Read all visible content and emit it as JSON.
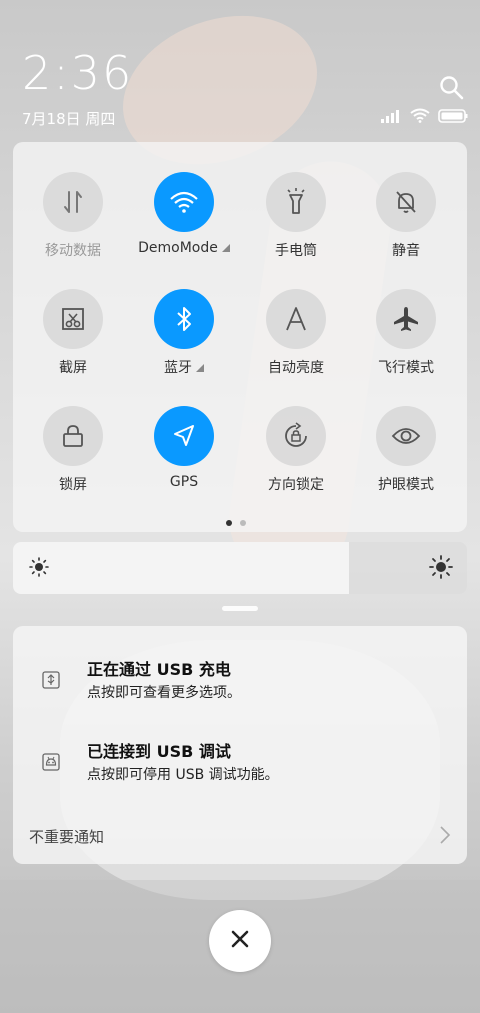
{
  "status": {
    "time": "2:36",
    "date": "7月18日 周四"
  },
  "tiles": [
    {
      "label": "移动数据",
      "icon": "mobile-data-icon",
      "on": false,
      "dim": true,
      "caret": false
    },
    {
      "label": "DemoMode",
      "icon": "wifi-icon",
      "on": true,
      "dim": false,
      "caret": true
    },
    {
      "label": "手电筒",
      "icon": "flashlight-icon",
      "on": false,
      "dim": false,
      "caret": false
    },
    {
      "label": "静音",
      "icon": "mute-bell-icon",
      "on": false,
      "dim": false,
      "caret": false
    },
    {
      "label": "截屏",
      "icon": "screenshot-icon",
      "on": false,
      "dim": false,
      "caret": false
    },
    {
      "label": "蓝牙",
      "icon": "bluetooth-icon",
      "on": true,
      "dim": false,
      "caret": true
    },
    {
      "label": "自动亮度",
      "icon": "auto-brightness-icon",
      "on": false,
      "dim": false,
      "caret": false
    },
    {
      "label": "飞行模式",
      "icon": "airplane-icon",
      "on": false,
      "dim": false,
      "caret": false
    },
    {
      "label": "锁屏",
      "icon": "lock-icon",
      "on": false,
      "dim": false,
      "caret": false
    },
    {
      "label": "GPS",
      "icon": "gps-icon",
      "on": true,
      "dim": false,
      "caret": false
    },
    {
      "label": "方向锁定",
      "icon": "rotation-lock-icon",
      "on": false,
      "dim": false,
      "caret": false
    },
    {
      "label": "护眼模式",
      "icon": "eye-icon",
      "on": false,
      "dim": false,
      "caret": false
    }
  ],
  "pager": {
    "pages": 2,
    "current": 0
  },
  "brightness": {
    "level": 0.74
  },
  "notifications": [
    {
      "title": "正在通过 USB 充电",
      "subtitle": "点按即可查看更多选项。",
      "icon": "android-usb-icon"
    },
    {
      "title": "已连接到 USB 调试",
      "subtitle": "点按即可停用 USB 调试功能。",
      "icon": "usb-debug-icon"
    }
  ],
  "unimportant": {
    "label": "不重要通知"
  },
  "colors": {
    "accent": "#0a99ff"
  }
}
